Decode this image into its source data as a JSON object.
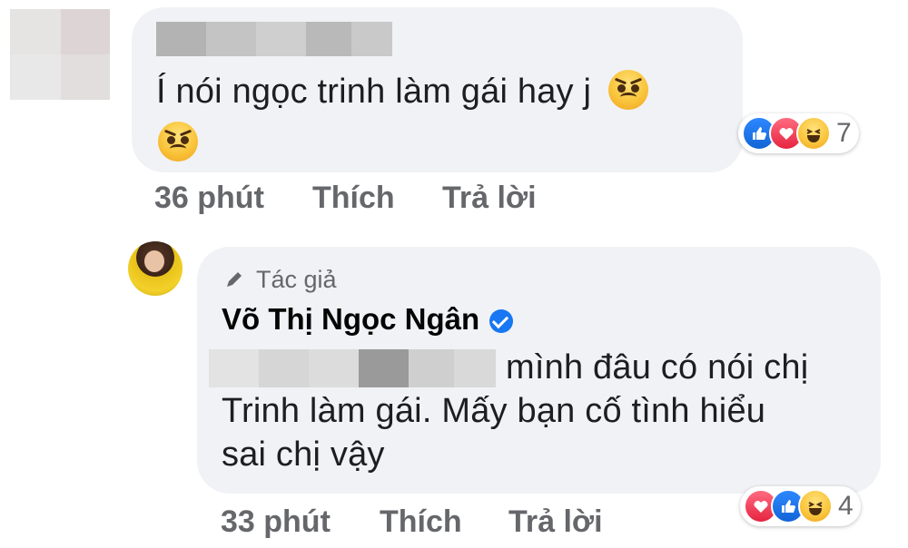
{
  "comment1": {
    "author_name_hidden": "",
    "text": "Í nói ngọc trinh làm gái hay j",
    "emoji_1": "angry-face-icon",
    "emoji_2": "angry-face-icon",
    "reactions": {
      "icons": [
        "like-icon",
        "love-icon",
        "haha-icon"
      ],
      "count": "7"
    },
    "time": "36 phút",
    "like_label": "Thích",
    "reply_label": "Trả lời"
  },
  "reply1": {
    "badge_label": "Tác giả",
    "badge_icon": "pencil-icon",
    "author_name": "Võ Thị Ngọc Ngân",
    "verified_icon": "verified-badge-icon",
    "text_line_1": "mình đâu có nói chị",
    "text_line_2": "Trinh làm gái. Mấy bạn cố tình hiểu",
    "text_line_3": "sai chị vậy",
    "reactions": {
      "icons": [
        "love-icon",
        "like-icon",
        "haha-icon"
      ],
      "count": "4"
    },
    "time": "33 phút",
    "like_label": "Thích",
    "reply_label": "Trả lời"
  },
  "colors": {
    "bubble_bg": "#f0f2f5",
    "meta_text": "#65676b",
    "verified_blue": "#1877f2"
  }
}
